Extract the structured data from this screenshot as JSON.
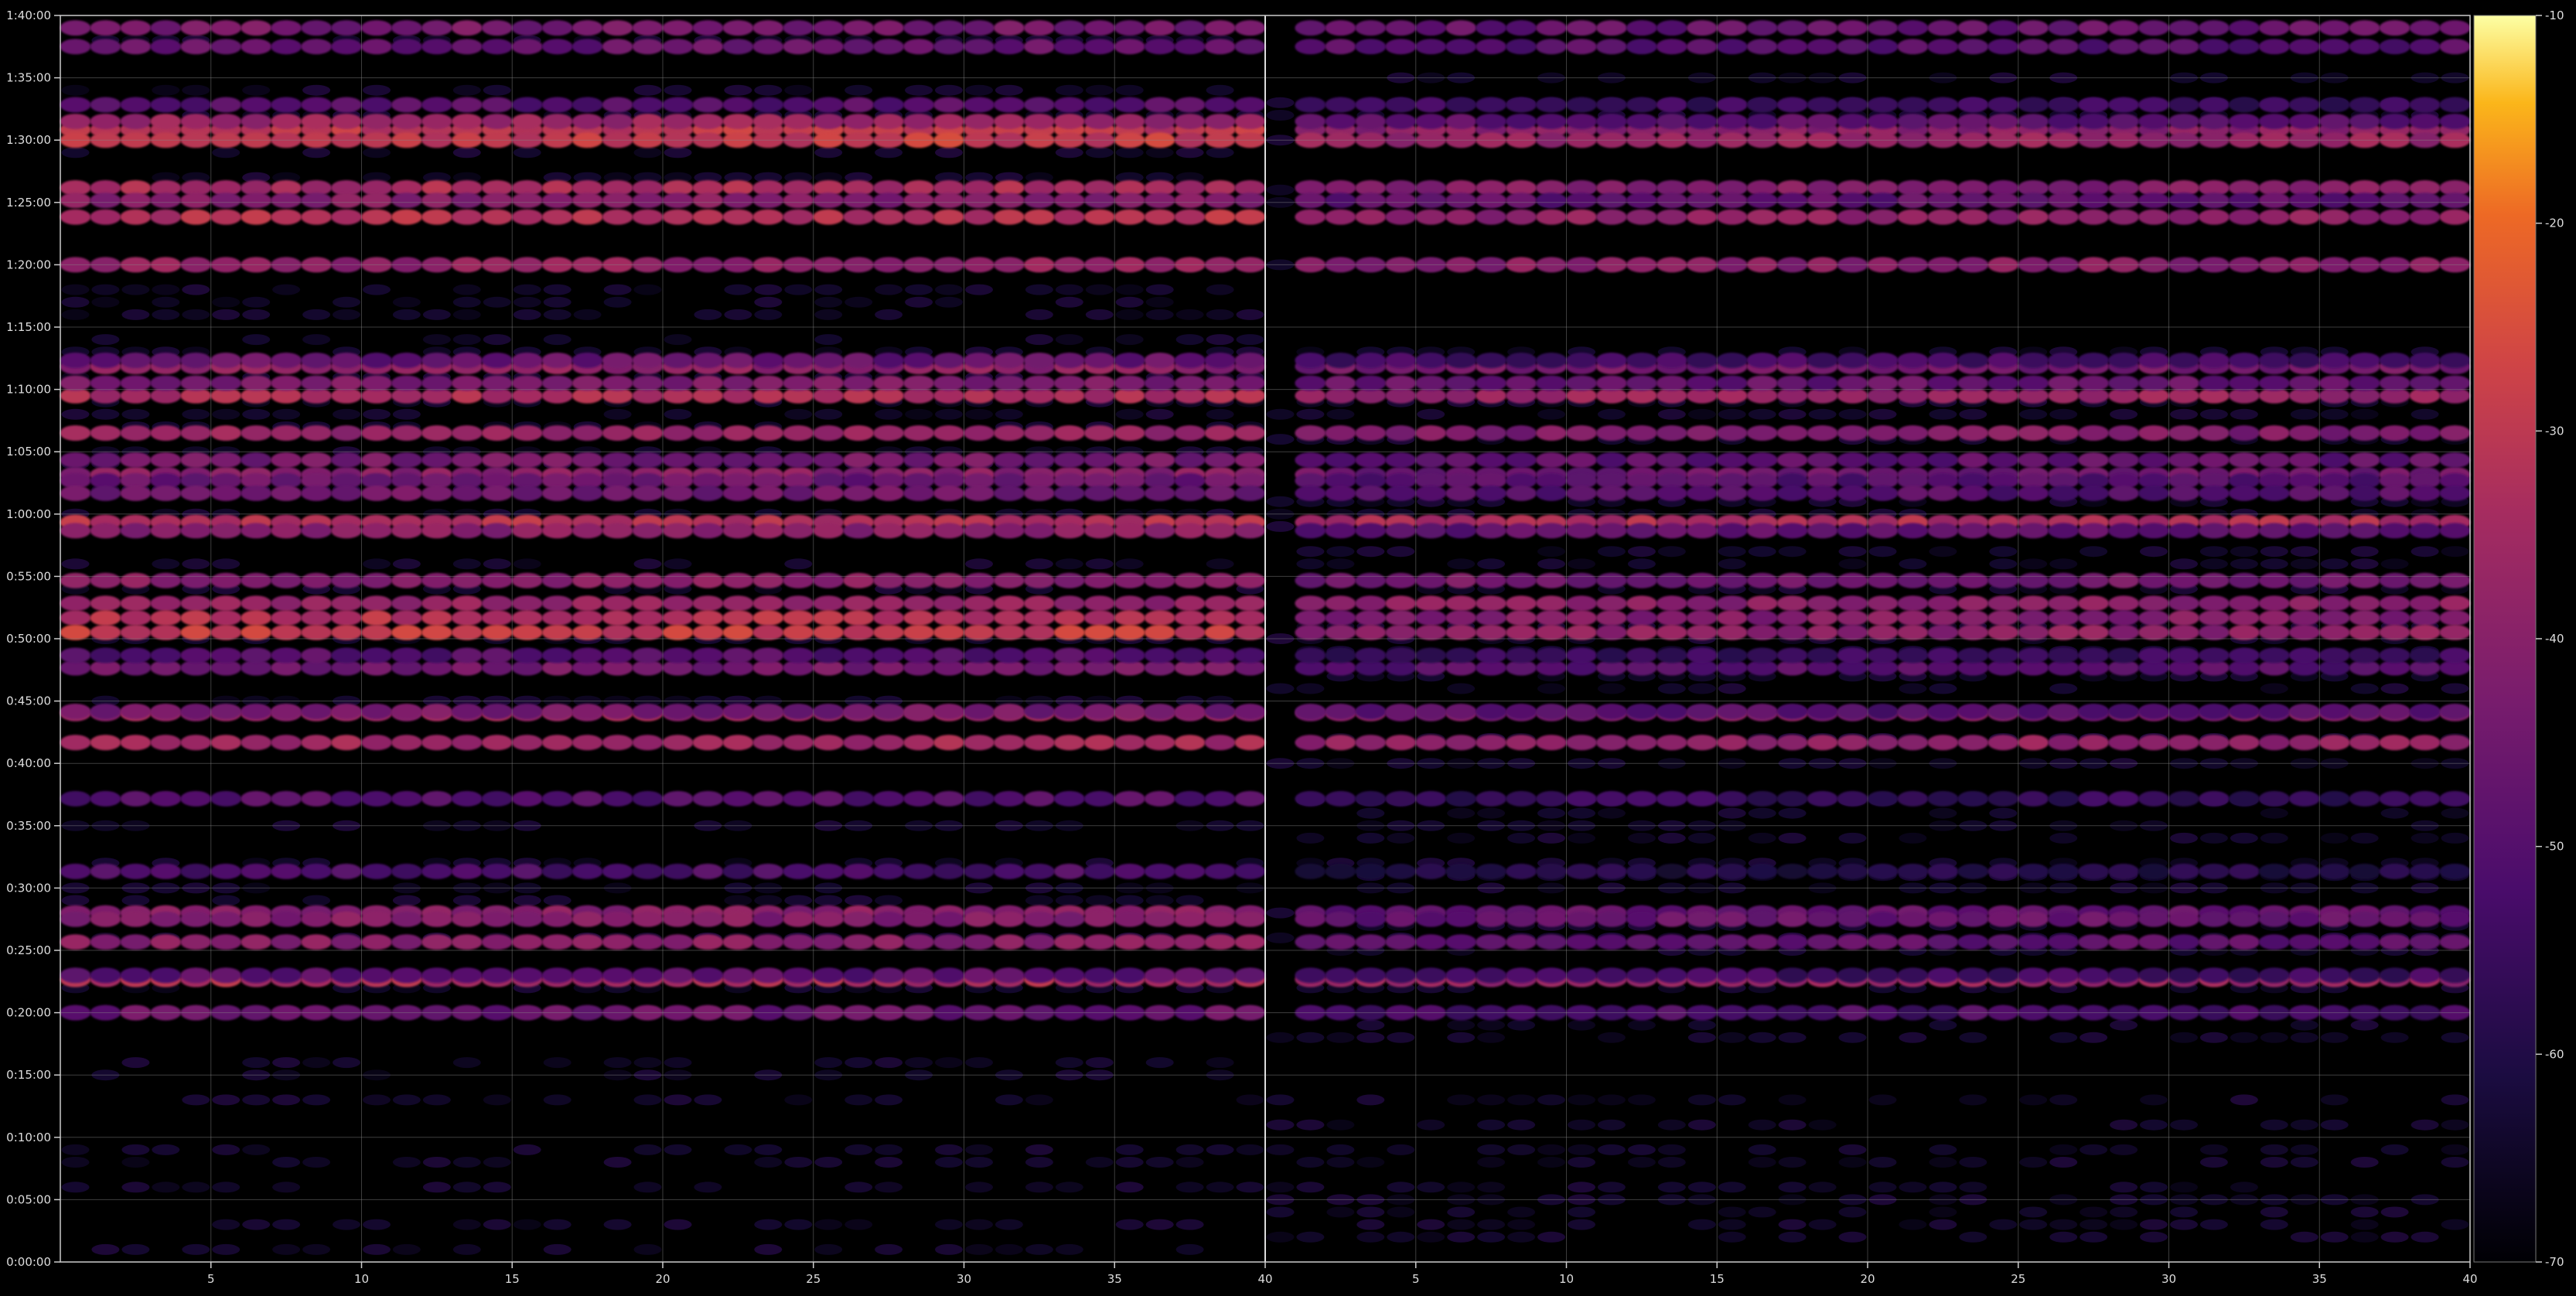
{
  "chart_data": {
    "type": "heatmap",
    "title": "",
    "xlabel": "",
    "ylabel": "",
    "panels": [
      {
        "name": "left",
        "x_range": [
          1,
          40
        ],
        "x_ticks": [
          5,
          10,
          15,
          20,
          25,
          30,
          35,
          40
        ],
        "x_tick_labels": [
          "5",
          "10",
          "15",
          "20",
          "25",
          "30",
          "35",
          "40"
        ]
      },
      {
        "name": "right",
        "x_range": [
          1,
          40
        ],
        "x_ticks": [
          5,
          10,
          15,
          20,
          25,
          30,
          35,
          40
        ],
        "x_tick_labels": [
          "5",
          "10",
          "15",
          "20",
          "25",
          "30",
          "35",
          "40"
        ]
      }
    ],
    "y_range_seconds": [
      0,
      6000
    ],
    "y_ticks_seconds": [
      0,
      300,
      600,
      900,
      1200,
      1500,
      1800,
      2100,
      2400,
      2700,
      3000,
      3300,
      3600,
      3900,
      4200,
      4500,
      4800,
      5100,
      5400,
      5700,
      6000
    ],
    "y_tick_labels": [
      "0:00:00",
      "0:05:00",
      "0:10:00",
      "0:15:00",
      "0:20:00",
      "0:25:00",
      "0:30:00",
      "0:35:00",
      "0:40:00",
      "0:45:00",
      "0:50:00",
      "0:55:00",
      "1:00:00",
      "1:05:00",
      "1:10:00",
      "1:15:00",
      "1:20:00",
      "1:25:00",
      "1:30:00",
      "1:35:00",
      "1:40:00"
    ],
    "grid": true,
    "colormap": "inferno",
    "colorbar": {
      "range": [
        -70,
        -10
      ],
      "ticks": [
        -10,
        -20,
        -30,
        -40,
        -50,
        -60,
        -70
      ],
      "tick_labels": [
        "-10",
        "-20",
        "-30",
        "-40",
        "-50",
        "-60",
        "-70"
      ]
    },
    "bands": [
      {
        "t": 2640,
        "left": -36,
        "right": -41
      },
      {
        "t": 2860,
        "left": -44,
        "right": -50
      },
      {
        "t": 2920,
        "left": -50,
        "right": -55
      },
      {
        "t": 4170,
        "left": -34,
        "right": -37
      },
      {
        "t": 3170,
        "left": -38,
        "right": -40
      },
      {
        "t": 3790,
        "left": -40,
        "right": -45
      },
      {
        "t": 3860,
        "left": -44,
        "right": -48
      },
      {
        "t": 3560,
        "left": -32,
        "right": -33
      },
      {
        "t": 3760,
        "left": -46,
        "right": -50
      },
      {
        "t": 4230,
        "left": -43,
        "right": -47
      },
      {
        "t": 1360,
        "left": -33,
        "right": -37
      },
      {
        "t": 1540,
        "left": -40,
        "right": -48
      },
      {
        "t": 3700,
        "left": -45,
        "right": -50
      },
      {
        "t": 3280,
        "left": -40,
        "right": -44
      },
      {
        "t": 3100,
        "left": -32,
        "right": -41
      },
      {
        "t": 3030,
        "left": -29,
        "right": -39
      },
      {
        "t": 2500,
        "left": -35,
        "right": -38
      },
      {
        "t": 1680,
        "left": -40,
        "right": -47
      },
      {
        "t": 5450,
        "left": -30,
        "right": -40
      },
      {
        "t": 5400,
        "left": -29,
        "right": -37
      },
      {
        "t": 5490,
        "left": -37,
        "right": -49
      },
      {
        "t": 5170,
        "left": -34,
        "right": -41
      },
      {
        "t": 5030,
        "left": -32,
        "right": -39
      },
      {
        "t": 5110,
        "left": -41,
        "right": -48
      },
      {
        "t": 3990,
        "left": -37,
        "right": -42
      },
      {
        "t": 4310,
        "left": -39,
        "right": -44
      },
      {
        "t": 1650,
        "left": -41,
        "right": -47
      },
      {
        "t": 2650,
        "left": -44,
        "right": -50
      },
      {
        "t": 3520,
        "left": -40,
        "right": -48
      },
      {
        "t": 1200,
        "left": -46,
        "right": -52
      },
      {
        "t": 2230,
        "left": -50,
        "right": -56
      },
      {
        "t": 1880,
        "left": -52,
        "right": -60
      },
      {
        "t": 5570,
        "left": -50,
        "right": -55
      },
      {
        "t": 5850,
        "left": -47,
        "right": -50
      },
      {
        "t": 5940,
        "left": -44,
        "right": -47
      },
      {
        "t": 4340,
        "left": -47,
        "right": -53
      },
      {
        "t": 1380,
        "left": -49,
        "right": -54
      },
      {
        "t": 4800,
        "left": -38,
        "right": -40
      }
    ]
  }
}
